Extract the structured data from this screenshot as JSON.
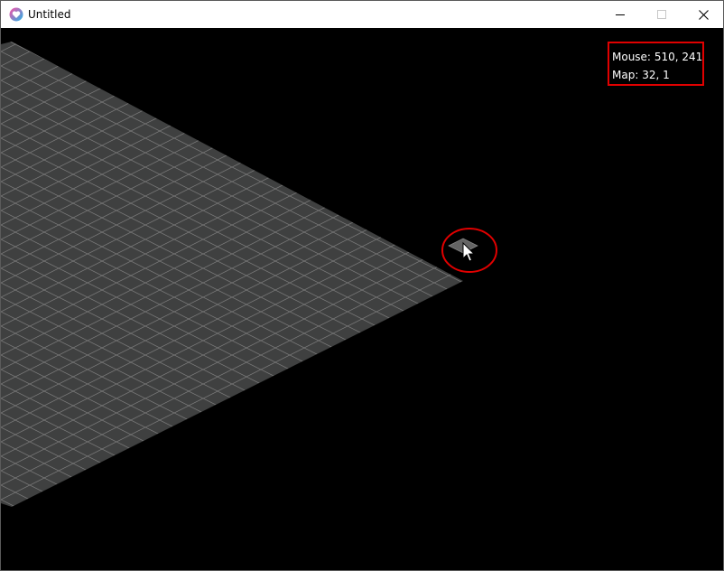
{
  "window": {
    "title": "Untitled",
    "app_icon": "heart-app-icon",
    "controls": [
      "minimize-icon",
      "maximize-icon",
      "close-icon"
    ]
  },
  "hud": {
    "mouse_label": "Mouse:",
    "mouse_value": "510, 241",
    "map_label": "Map:",
    "map_value": "32, 1"
  },
  "scene": {
    "background_color": "#000000",
    "tile_fill": "#3f4040",
    "tile_edge": "#7a7a7a",
    "highlight_fill": "#646464",
    "annotation_color": "#e00000",
    "cursor_icon": "mouse-pointer-icon"
  }
}
